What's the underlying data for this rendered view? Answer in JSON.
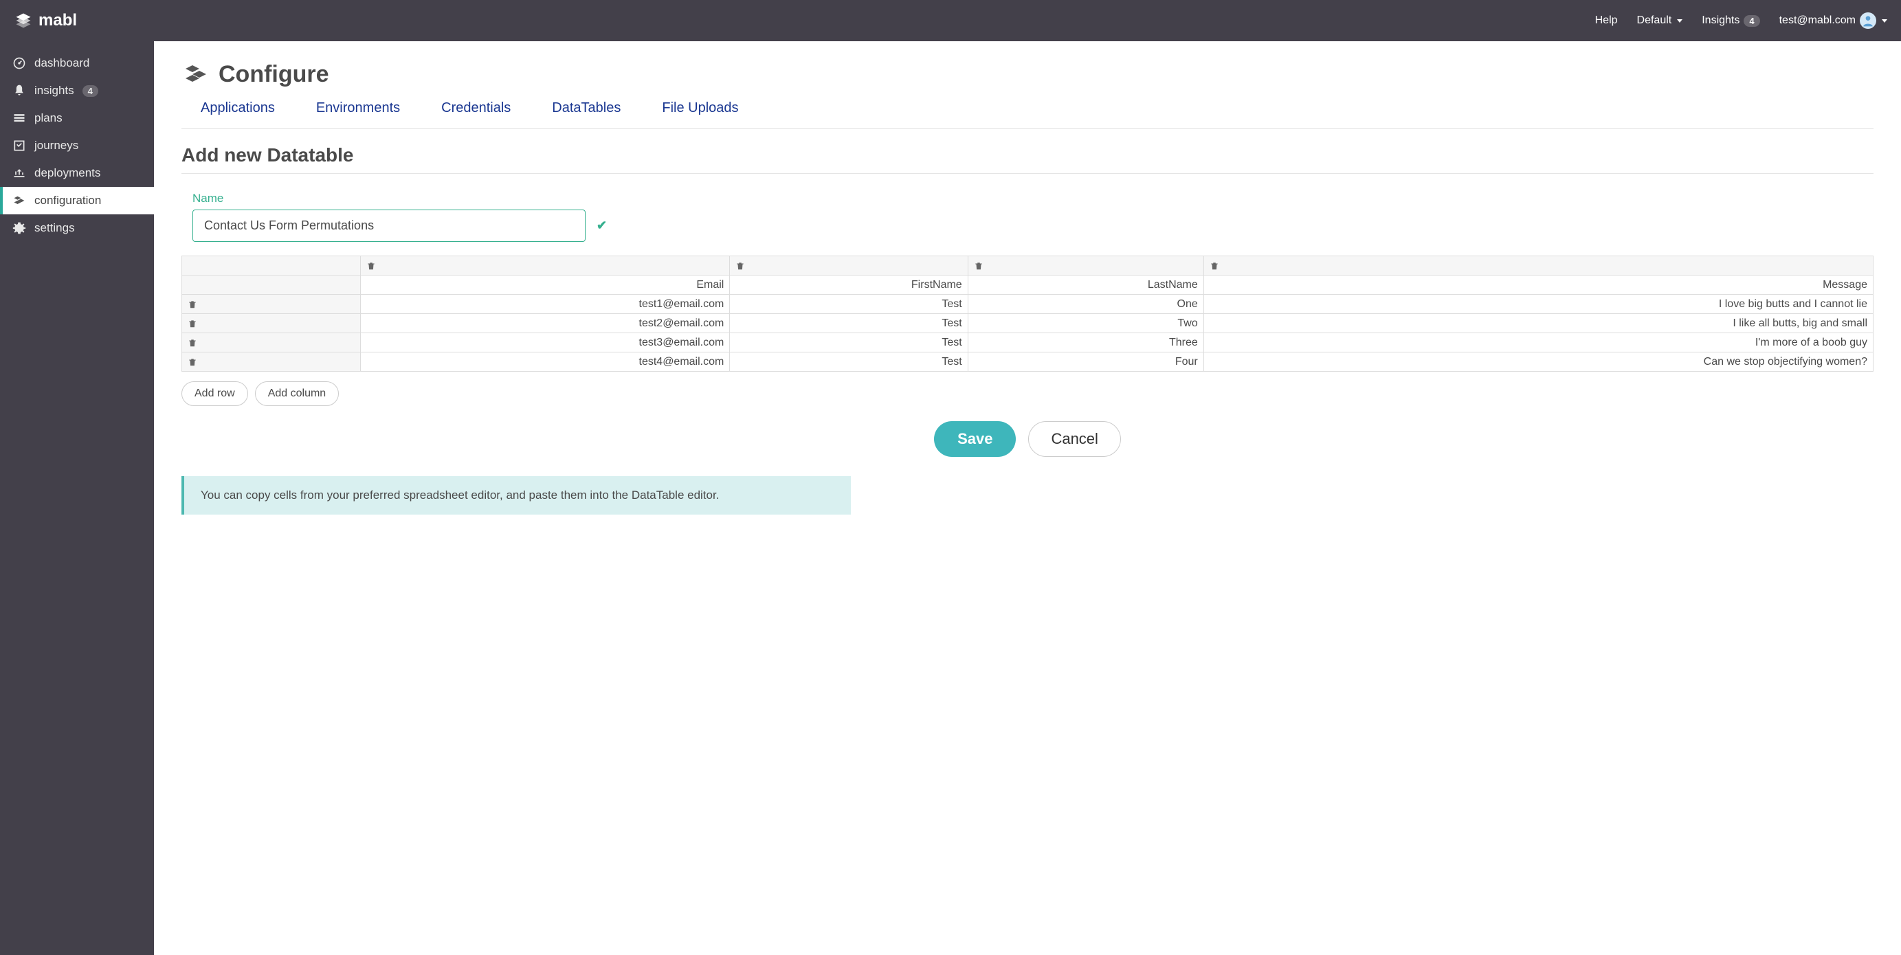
{
  "header": {
    "brand": "mabl",
    "help": "Help",
    "workspace": "Default",
    "insights_label": "Insights",
    "insights_count": "4",
    "user_email": "test@mabl.com"
  },
  "sidebar": {
    "items": [
      {
        "label": "dashboard"
      },
      {
        "label": "insights",
        "badge": "4"
      },
      {
        "label": "plans"
      },
      {
        "label": "journeys"
      },
      {
        "label": "deployments"
      },
      {
        "label": "configuration"
      },
      {
        "label": "settings"
      }
    ]
  },
  "page": {
    "title": "Configure",
    "section_title": "Add new Datatable",
    "name_label": "Name",
    "name_value": "Contact Us Form Permutations"
  },
  "tabs": {
    "applications": "Applications",
    "environments": "Environments",
    "credentials": "Credentials",
    "datatables": "DataTables",
    "fileuploads": "File Uploads"
  },
  "table": {
    "columns": [
      "Email",
      "FirstName",
      "LastName",
      "Message"
    ],
    "rows": [
      [
        "test1@email.com",
        "Test",
        "One",
        "I love big butts and I cannot lie"
      ],
      [
        "test2@email.com",
        "Test",
        "Two",
        "I like all butts, big and small"
      ],
      [
        "test3@email.com",
        "Test",
        "Three",
        "I'm more of a boob guy"
      ],
      [
        "test4@email.com",
        "Test",
        "Four",
        "Can we stop objectifying women?"
      ]
    ]
  },
  "buttons": {
    "add_row": "Add row",
    "add_column": "Add column",
    "save": "Save",
    "cancel": "Cancel"
  },
  "info": "You can copy cells from your preferred spreadsheet editor, and paste them into the DataTable editor."
}
